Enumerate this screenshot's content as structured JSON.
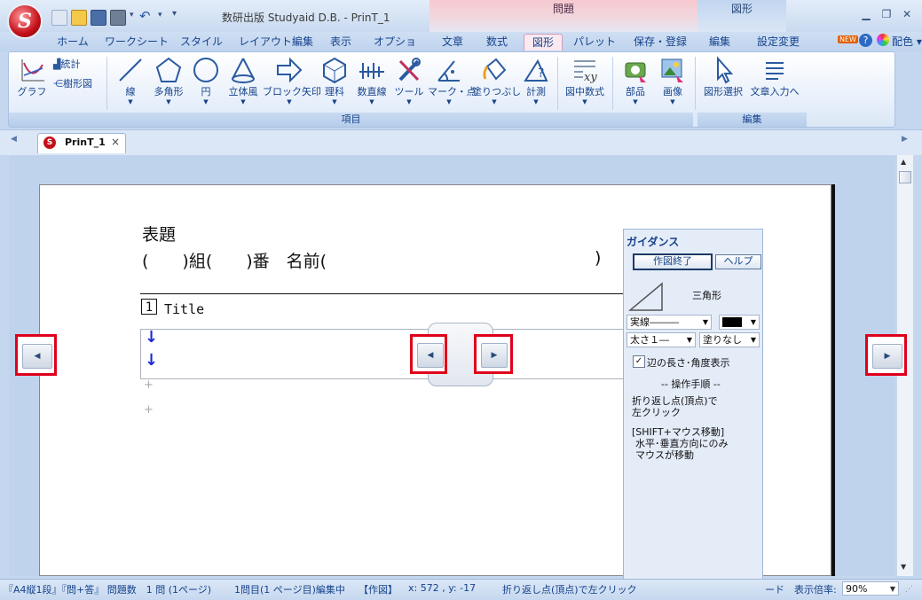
{
  "app": {
    "logo_letter": "S",
    "title": "数研出版 Studyaid D.B. - PrinT_1"
  },
  "contextual": {
    "mondai": "問題",
    "zukei": "図形"
  },
  "tabs": [
    "ホーム",
    "ワークシート",
    "スタイル",
    "レイアウト編集",
    "表示",
    "オプション",
    "文章",
    "数式",
    "図形",
    "パレット",
    "保存・登録",
    "編集",
    "設定変更"
  ],
  "right_menu": {
    "new_badge": "NEW",
    "help": "?",
    "color_label": "配色"
  },
  "ribbon": {
    "graph": "グラフ",
    "stats": "統計",
    "tree": "樹形図",
    "items": [
      "線",
      "多角形",
      "円",
      "立体風",
      "ブロック矢印",
      "理科",
      "数直線",
      "ツール",
      "マーク・点",
      "塗りつぶし",
      "計測",
      "図中数式",
      "部品",
      "画像",
      "図形選択",
      "文章入力へ"
    ],
    "group_koumoku": "項目",
    "group_hensyu": "編集"
  },
  "doc_tab": {
    "label": "PrinT_1",
    "close": "×"
  },
  "document": {
    "heading": "表題",
    "name_line": "(　　)組(　　)番　名前(",
    "name_close": ")",
    "q_number": "1",
    "q_title": "Title",
    "arrow1": "↓",
    "arrow2": "↓",
    "plus1": "+",
    "plus2": "+"
  },
  "guidance": {
    "title": "ガイダンス",
    "finish_btn": "作図終了",
    "help_btn": "ヘルプ",
    "shape_name": "三角形",
    "line_style": "実線―――",
    "line_width": "太さ１―",
    "fill": "塗りなし",
    "checkbox_label": "辺の長さ･角度表示",
    "checked": true,
    "steps_header": "-- 操作手順 --",
    "step1": "折り返し点(頂点)で",
    "step2": "左クリック",
    "step3": "[SHIFT+マウス移動]",
    "step4": "水平･垂直方向にのみ",
    "step5": "マウスが移動"
  },
  "status": {
    "layout": "『A4縦1段』『問+答』 問題数　1 問 (1ページ)",
    "editing": "1問目(1 ページ目)編集中",
    "mode": "【作図】",
    "coords": "x: 572 , y: -17",
    "hint": "折り返し点(頂点)で左クリック",
    "mode2": "ード",
    "zoom_label": "表示倍率:",
    "zoom_value": "90%"
  }
}
